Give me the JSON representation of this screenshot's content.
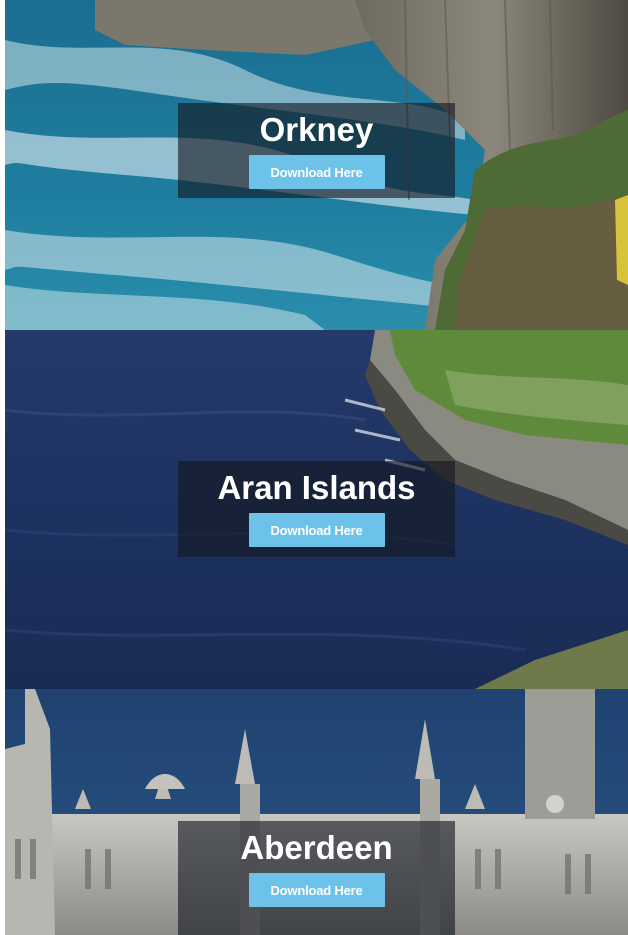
{
  "destinations": [
    {
      "title": "Orkney",
      "button_label": "Download Here"
    },
    {
      "title": "Aran Islands",
      "button_label": "Download Here"
    },
    {
      "title": "Aberdeen",
      "button_label": "Download Here"
    }
  ],
  "colors": {
    "button": "#6cc2e8",
    "overlay": "#14182a",
    "sea_orkney": "#1d6c8e",
    "sea_aran": "#1e3262",
    "sky_aberdeen": "#254a78"
  }
}
